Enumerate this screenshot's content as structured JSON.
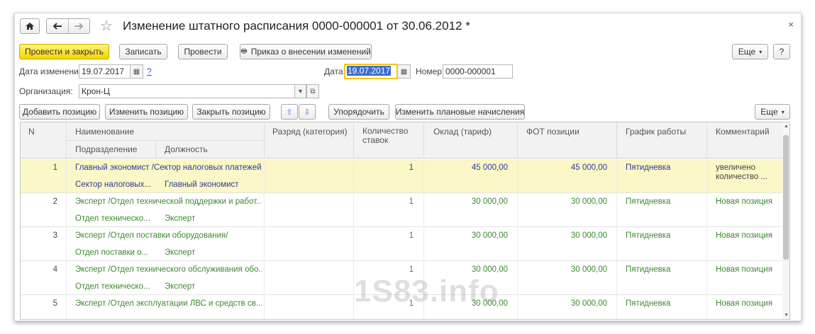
{
  "window": {
    "title": "Изменение штатного расписания 0000-000001 от 30.06.2012 *"
  },
  "toolbar": {
    "post_close": "Провести и закрыть",
    "save": "Записать",
    "post": "Провести",
    "order": "Приказ о внесении изменений",
    "more": "Еще",
    "help": "?"
  },
  "header": {
    "change_date_label": "Дата изменений:",
    "change_date_value": "19.07.2017",
    "help_link": "?",
    "date_label": "Дата:",
    "date_value": "19.07.2017",
    "number_label": "Номер:",
    "number_value": "0000-000001",
    "org_label": "Организация:",
    "org_value": "Крон-Ц"
  },
  "table_toolbar": {
    "add": "Добавить позицию",
    "edit": "Изменить позицию",
    "close": "Закрыть позицию",
    "sort": "Упорядочить",
    "planned": "Изменить плановые начисления",
    "more": "Еще"
  },
  "columns": {
    "n": "N",
    "name": "Наименование",
    "dept": "Подразделение",
    "position": "Должность",
    "grade": "Разряд (категория)",
    "rates": "Количество ставок",
    "salary": "Оклад (тариф)",
    "fot": "ФОТ позиции",
    "schedule": "График работы",
    "comment": "Комментарий"
  },
  "rows": [
    {
      "n": "1",
      "name": "Главный экономист /Сектор налоговых платежей...",
      "dept": "Сектор налоговых...",
      "position": "Главный экономист",
      "rates": "1",
      "salary": "45 000,00",
      "fot": "45 000,00",
      "schedule": "Пятидневка",
      "comment": "увеличено",
      "comment2": "количество ..."
    },
    {
      "n": "2",
      "name": "Эксперт /Отдел технической поддержки и работ...",
      "dept": "Отдел техническо...",
      "position": "Эксперт",
      "rates": "1",
      "salary": "30 000,00",
      "fot": "30 000,00",
      "schedule": "Пятидневка",
      "comment": "Новая позиция",
      "comment2": ""
    },
    {
      "n": "3",
      "name": "Эксперт /Отдел поставки оборудования/",
      "dept": "Отдел поставки о...",
      "position": "Эксперт",
      "rates": "1",
      "salary": "30 000,00",
      "fot": "30 000,00",
      "schedule": "Пятидневка",
      "comment": "Новая позиция",
      "comment2": ""
    },
    {
      "n": "4",
      "name": "Эксперт /Отдел технического обслуживания обо...",
      "dept": "Отдел техническо...",
      "position": "Эксперт",
      "rates": "1",
      "salary": "30 000,00",
      "fot": "30 000,00",
      "schedule": "Пятидневка",
      "comment": "Новая позиция",
      "comment2": ""
    },
    {
      "n": "5",
      "name": "Эксперт /Отдел эксплуатации ЛВС и средств св...",
      "dept": "",
      "position": "",
      "rates": "1",
      "salary": "30 000,00",
      "fot": "30 000,00",
      "schedule": "Пятидневка",
      "comment": "Новая позиция",
      "comment2": ""
    }
  ],
  "watermark": "1S83.info",
  "colors": {
    "primary_button": "#f5d400",
    "selected_row": "#fbf7c6",
    "green_text": "#3c8a2e",
    "blue_text": "#2b3c9a",
    "focus_border": "#f5c518"
  }
}
